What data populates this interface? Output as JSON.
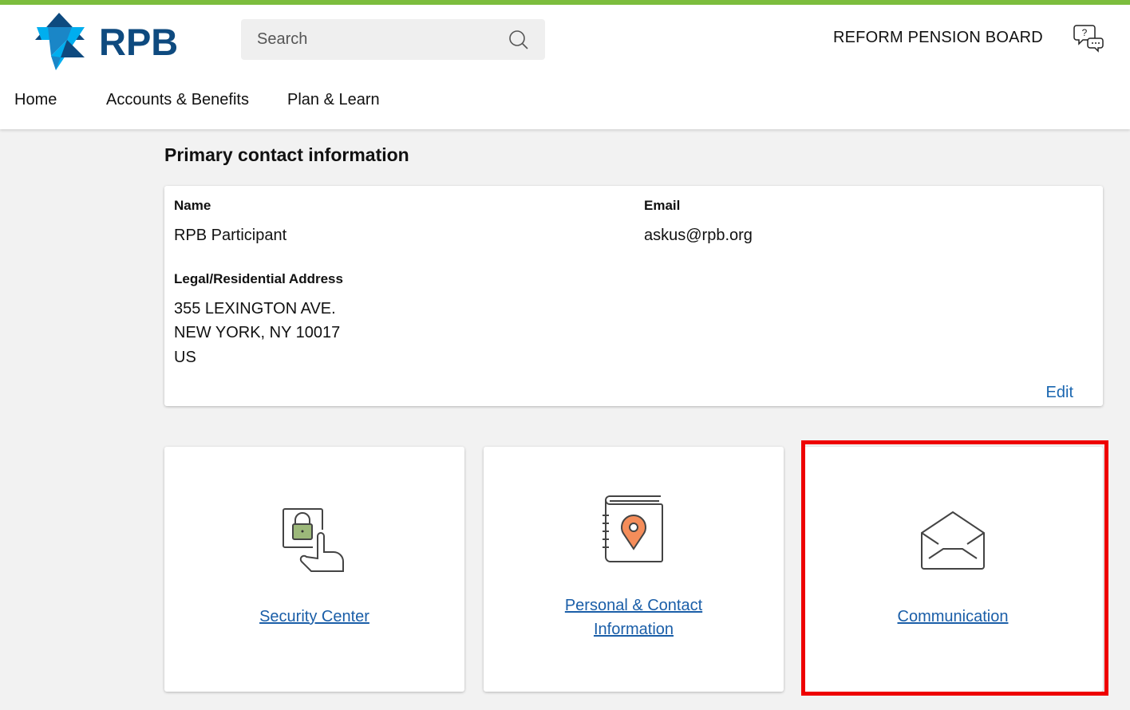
{
  "header": {
    "logo_text": "RPB",
    "search_placeholder": "Search",
    "org_name": "REFORM PENSION BOARD",
    "help_icon": "chat-help-icon"
  },
  "nav": {
    "items": [
      {
        "label": "Home"
      },
      {
        "label": "Accounts & Benefits"
      },
      {
        "label": "Plan & Learn"
      }
    ]
  },
  "contact": {
    "title": "Primary contact information",
    "name_label": "Name",
    "name_value": "RPB Participant",
    "email_label": "Email",
    "email_value": "askus@rpb.org",
    "address_label": "Legal/Residential Address",
    "address_line1": "355 LEXINGTON AVE.",
    "address_line2": "NEW YORK, NY 10017",
    "address_line3": "US",
    "edit_label": "Edit"
  },
  "tiles": [
    {
      "label": "Security Center",
      "icon": "lock-touch-icon"
    },
    {
      "label_line1": "Personal & Contact",
      "label_line2": "Information",
      "icon": "address-book-pin-icon"
    },
    {
      "label": "Communication",
      "icon": "open-envelope-icon"
    }
  ],
  "colors": {
    "accent_green": "#7cbd3d",
    "brand_blue": "#0e4a7f",
    "link_blue": "#1a5ea8",
    "highlight_red": "#ee0000",
    "lock_green": "#9cb87a",
    "pin_orange": "#f58d5a"
  }
}
